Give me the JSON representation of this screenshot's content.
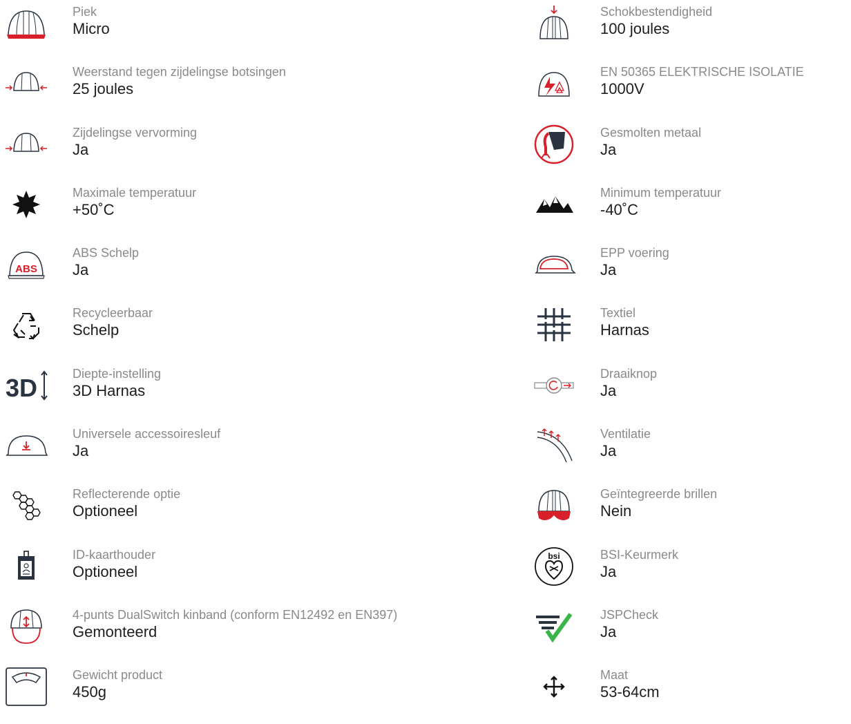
{
  "left": [
    {
      "label": "Piek",
      "value": "Micro",
      "icon": "helmet-peak-icon"
    },
    {
      "label": "Weerstand tegen zijdelingse botsingen",
      "value": "25 joules",
      "icon": "helmet-lateral-impact-icon"
    },
    {
      "label": "Zijdelingse vervorming",
      "value": "Ja",
      "icon": "helmet-lateral-deformation-icon"
    },
    {
      "label": "Maximale temperatuur",
      "value": "+50˚C",
      "icon": "sun-icon"
    },
    {
      "label": "ABS Schelp",
      "value": "Ja",
      "icon": "abs-helmet-icon"
    },
    {
      "label": "Recycleerbaar",
      "value": "Schelp",
      "icon": "recycle-icon"
    },
    {
      "label": "Diepte-instelling",
      "value": "3D Harnas",
      "icon": "3d-depth-icon"
    },
    {
      "label": "Universele accessoiresleuf",
      "value": "Ja",
      "icon": "accessory-slot-icon"
    },
    {
      "label": "Reflecterende optie",
      "value": "Optioneel",
      "icon": "hexagons-icon"
    },
    {
      "label": "ID-kaarthouder",
      "value": "Optioneel",
      "icon": "id-card-icon"
    },
    {
      "label": "4-punts DualSwitch kinband (conform EN12492 en EN397)",
      "value": "Gemonteerd",
      "icon": "chinstrap-helmet-icon"
    },
    {
      "label": "Gewicht product",
      "value": "450g",
      "icon": "scale-icon"
    }
  ],
  "right": [
    {
      "label": "Schokbestendigheid",
      "value": "100 joules",
      "icon": "helmet-top-impact-icon"
    },
    {
      "label": "EN 50365 ELEKTRISCHE ISOLATIE",
      "value": "1000V",
      "icon": "electrical-insulation-icon"
    },
    {
      "label": "Gesmolten metaal",
      "value": "Ja",
      "icon": "molten-metal-icon"
    },
    {
      "label": "Minimum temperatuur",
      "value": "-40˚C",
      "icon": "mountains-icon"
    },
    {
      "label": "EPP voering",
      "value": "Ja",
      "icon": "epp-liner-icon"
    },
    {
      "label": "Textiel",
      "value": "Harnas",
      "icon": "textile-icon"
    },
    {
      "label": "Draaiknop",
      "value": "Ja",
      "icon": "wheel-ratchet-icon"
    },
    {
      "label": "Ventilatie",
      "value": "Ja",
      "icon": "ventilation-icon"
    },
    {
      "label": "Geïntegreerde brillen",
      "value": "Nein",
      "icon": "helmet-goggles-icon"
    },
    {
      "label": "BSI-Keurmerk",
      "value": "Ja",
      "icon": "bsi-kitemark-icon"
    },
    {
      "label": "JSPCheck",
      "value": "Ja",
      "icon": "jspcheck-icon"
    },
    {
      "label": "Maat",
      "value": "53-64cm",
      "icon": "move-arrows-icon"
    }
  ],
  "colors": {
    "label": "#8a8a8a",
    "value": "#1e1e1e",
    "accent": "#d8202a",
    "icon": "#2a3340",
    "check": "#3bb54a"
  }
}
